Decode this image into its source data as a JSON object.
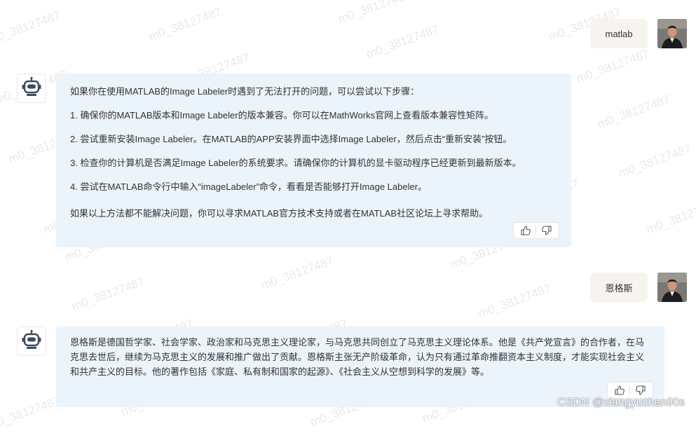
{
  "watermark": "m0_38127487",
  "conversation": [
    {
      "role": "user",
      "text": "matlab"
    },
    {
      "role": "assistant",
      "paragraphs": [
        "如果你在使用MATLAB的Image Labeler时遇到了无法打开的问题，可以尝试以下步骤：",
        "1. 确保你的MATLAB版本和Image Labeler的版本兼容。你可以在MathWorks官网上查看版本兼容性矩阵。",
        "2. 尝试重新安装Image Labeler。在MATLAB的APP安装界面中选择Image Labeler，然后点击“重新安装”按钮。",
        "3. 检查你的计算机是否满足Image Labeler的系统要求。请确保你的计算机的显卡驱动程序已经更新到最新版本。",
        "4. 尝试在MATLAB命令行中输入“imageLabeler”命令，看看是否能够打开Image Labeler。",
        "如果以上方法都不能解决问题，你可以寻求MATLAB官方技术支持或者在MATLAB社区论坛上寻求帮助。"
      ]
    },
    {
      "role": "user",
      "text": "恩格斯"
    },
    {
      "role": "assistant",
      "paragraphs": [
        "恩格斯是德国哲学家、社会学家、政治家和马克思主义理论家，与马克思共同创立了马克思主义理论体系。他是《共产党宣言》的合作者，在马克思去世后，继续为马克思主义的发展和推广做出了贡献。恩格斯主张无产阶级革命，认为只有通过革命推翻资本主义制度，才能实现社会主义和共产主义的目标。他的著作包括《家庭、私有制和国家的起源》、《社会主义从空想到科学的发展》等。"
      ]
    }
  ],
  "credit": "CSDN @xiangyuchen90s",
  "colors": {
    "user_bubble": "#f7f4ef",
    "assistant_bubble": "#ebf3fb",
    "bot_icon": "#3c4a5e"
  },
  "icons": {
    "assistant_avatar": "robot-icon",
    "like": "thumbs-up-icon",
    "dislike": "thumbs-down-icon"
  }
}
